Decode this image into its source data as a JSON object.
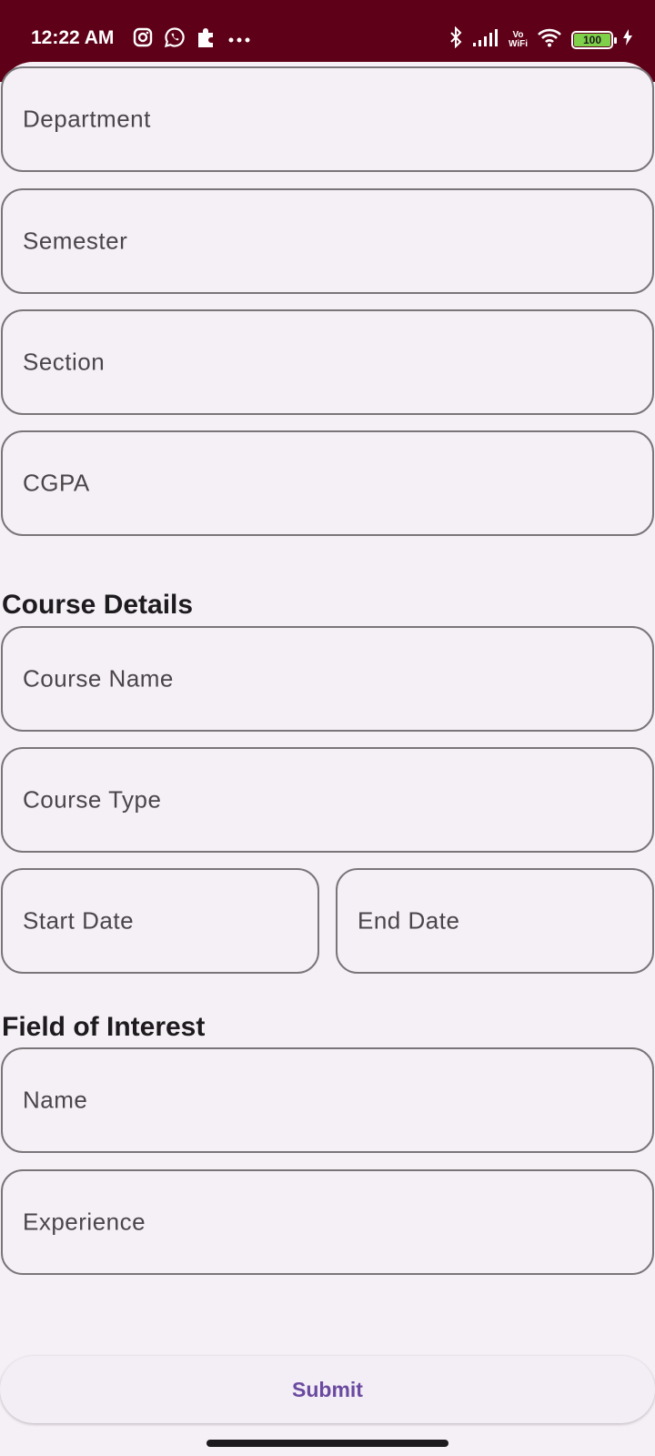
{
  "status_bar": {
    "time": "12:22 AM",
    "vowifi_top": "Vo",
    "vowifi_bottom": "WiFi",
    "battery": "100",
    "background_color": "#5e0018"
  },
  "form": {
    "fields_top": [
      {
        "label": "Department"
      },
      {
        "label": "Semester"
      },
      {
        "label": "Section"
      },
      {
        "label": "CGPA"
      }
    ],
    "course_details": {
      "title": "Course Details",
      "course_name": "Course Name",
      "course_type": "Course Type",
      "start_date": "Start Date",
      "end_date": "End Date"
    },
    "field_of_interest": {
      "title": "Field of Interest",
      "name": "Name",
      "experience": "Experience"
    },
    "submit_label": "Submit"
  },
  "colors": {
    "background": "#f5f0f6",
    "field_border": "#7a7578",
    "accent": "#6a4aa0"
  }
}
